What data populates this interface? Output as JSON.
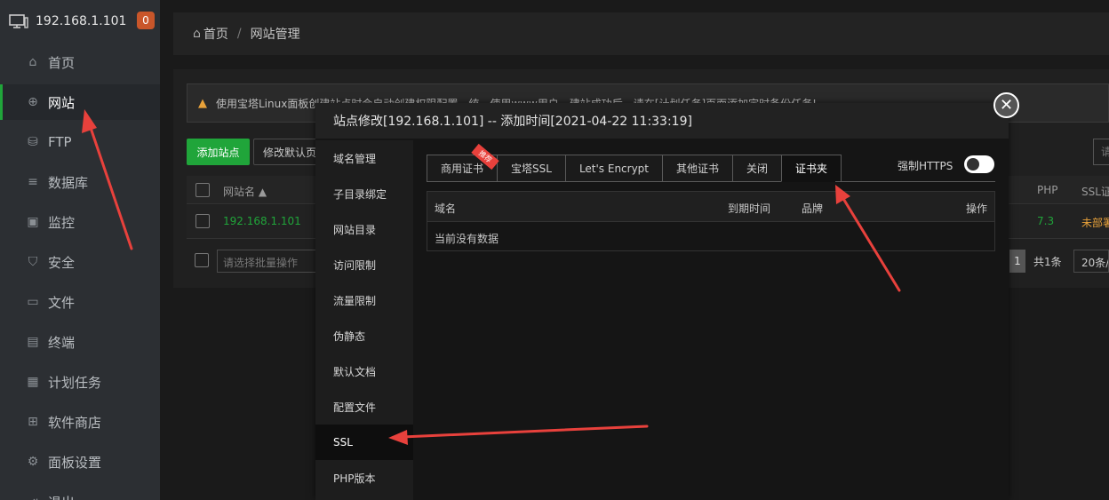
{
  "sidebar": {
    "server_ip": "192.168.1.101",
    "badge": "0",
    "items": [
      {
        "label": "首页",
        "icon": "home-icon",
        "glyph": "⌂"
      },
      {
        "label": "网站",
        "icon": "globe-icon",
        "glyph": "⊕"
      },
      {
        "label": "FTP",
        "icon": "ftp-icon",
        "glyph": "⛁"
      },
      {
        "label": "数据库",
        "icon": "database-icon",
        "glyph": "≡"
      },
      {
        "label": "监控",
        "icon": "monitor-icon",
        "glyph": "▣"
      },
      {
        "label": "安全",
        "icon": "shield-icon",
        "glyph": "⛉"
      },
      {
        "label": "文件",
        "icon": "folder-icon",
        "glyph": "▭"
      },
      {
        "label": "终端",
        "icon": "terminal-icon",
        "glyph": "▤"
      },
      {
        "label": "计划任务",
        "icon": "calendar-icon",
        "glyph": "▦"
      },
      {
        "label": "软件商店",
        "icon": "apps-icon",
        "glyph": "⊞"
      },
      {
        "label": "面板设置",
        "icon": "gear-icon",
        "glyph": "⚙"
      },
      {
        "label": "退出",
        "icon": "logout-icon",
        "glyph": "⇥"
      }
    ]
  },
  "breadcrumb": {
    "home": "首页",
    "separator": "/",
    "current": "网站管理"
  },
  "notice_text": "使用宝塔Linux面板创建站点时会自动创建权限配置，统一使用www用户。建站成功后，请在[计划任务]页面添加定时备份任务!",
  "toolbar": {
    "add_site": "添加站点",
    "modify_default": "修改默认页",
    "search_placeholder": "请"
  },
  "site_table": {
    "col_name": "网站名 ▲",
    "col_php": "PHP",
    "col_ssl": "SSL证",
    "row_name": "192.168.1.101",
    "row_php": "7.3",
    "row_ssl": "未部署",
    "batch_placeholder": "请选择批量操作",
    "page_current": "1",
    "page_total": "共1条",
    "page_size": "20条/"
  },
  "modal": {
    "title": "站点修改[192.168.1.101] -- 添加时间[2021-04-22 11:33:19]",
    "close_glyph": "✕",
    "menu": [
      "域名管理",
      "子目录绑定",
      "网站目录",
      "访问限制",
      "流量限制",
      "伪静态",
      "默认文档",
      "配置文件",
      "SSL",
      "PHP版本"
    ],
    "tabs": [
      "商用证书",
      "宝塔SSL",
      "Let's Encrypt",
      "其他证书",
      "关闭",
      "证书夹"
    ],
    "recommend_ribbon": "推荐",
    "force_https": "强制HTTPS",
    "cert_table": {
      "col_domain": "域名",
      "col_expiry": "到期时间",
      "col_brand": "品牌",
      "col_action": "操作",
      "empty": "当前没有数据"
    }
  },
  "colors": {
    "accent_green": "#20a53a",
    "badge_orange": "#c9562a",
    "annotation_red": "#e8413c"
  }
}
